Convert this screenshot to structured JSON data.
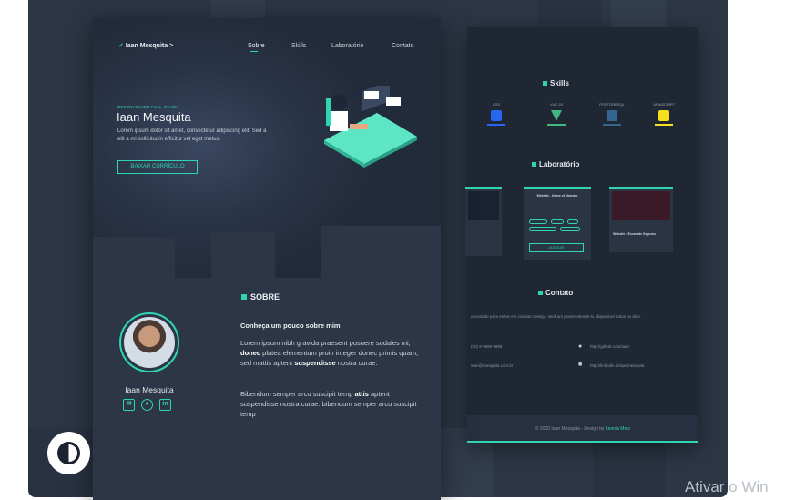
{
  "front": {
    "logo": "Iaan Mesquita >",
    "nav": [
      "Sobre",
      "Skills",
      "Laboratório",
      "Contato"
    ],
    "hero": {
      "eyebrow": "DESENVOLVER FULL-STACK",
      "name": "Iaan Mesquita",
      "description": "Lorem ipsum dolor sit amet, consectetur adipiscing elit. Sed a elit a mi sollicitudin efficitur vel eget metus.",
      "cta": "BAIXAR CURRÍCULO"
    },
    "about": {
      "title": "SOBRE",
      "name": "Iaan Mesquita",
      "heading": "Conheça um pouco sobre mim",
      "p1_a": "Lorem ipsum nibh gravida praesent posuere sodales mi, ",
      "p1_b": "donec",
      "p1_c": " platea elementum proin integer donec primis quam, sed mattis aptent ",
      "p1_d": "suspendisse",
      "p1_e": " nostra curae.",
      "p2_a": "Bibendum semper arcu suscipit temp ",
      "p2_b": "attis",
      "p2_c": " aptent suspendisse nostra curae. bibendum semper arcu suscipit temp"
    }
  },
  "back": {
    "skills_title": "Skills",
    "skills": [
      {
        "name": "CSS",
        "color": "#2965f1"
      },
      {
        "name": "VUE.JS",
        "color": "#41b883"
      },
      {
        "name": "POSTGRESQL",
        "color": "#336791"
      },
      {
        "name": "JAVASCRIPT",
        "color": "#f7df1e"
      }
    ],
    "lab_title": "Laboratório",
    "lab_cards": [
      {
        "title": "Website - Game of Monster",
        "button": "ACESSAR"
      },
      {
        "title": "Website - Escarlate Seguros"
      }
    ],
    "contact_title": "Contato",
    "contact_intro": "a vontade para entrar em contato comigo, será um prazer atende-lo. disponível todos os dias.",
    "contacts": {
      "phone": "(00) 9 9999 9999",
      "github": "http://github.com/iaan",
      "email": "iaan@mesquita.com.br",
      "linkedin": "http://linkedin.in/iaanmesquita"
    },
    "footer_a": "© 2020 Iaan Mesquita - Design by ",
    "footer_b": "Leonia Melo"
  },
  "watermark": "Ativar o Win",
  "colors": {
    "accent": "#2fd4b0",
    "page_bg": "#2c3645",
    "back_bg": "#1f2733"
  }
}
